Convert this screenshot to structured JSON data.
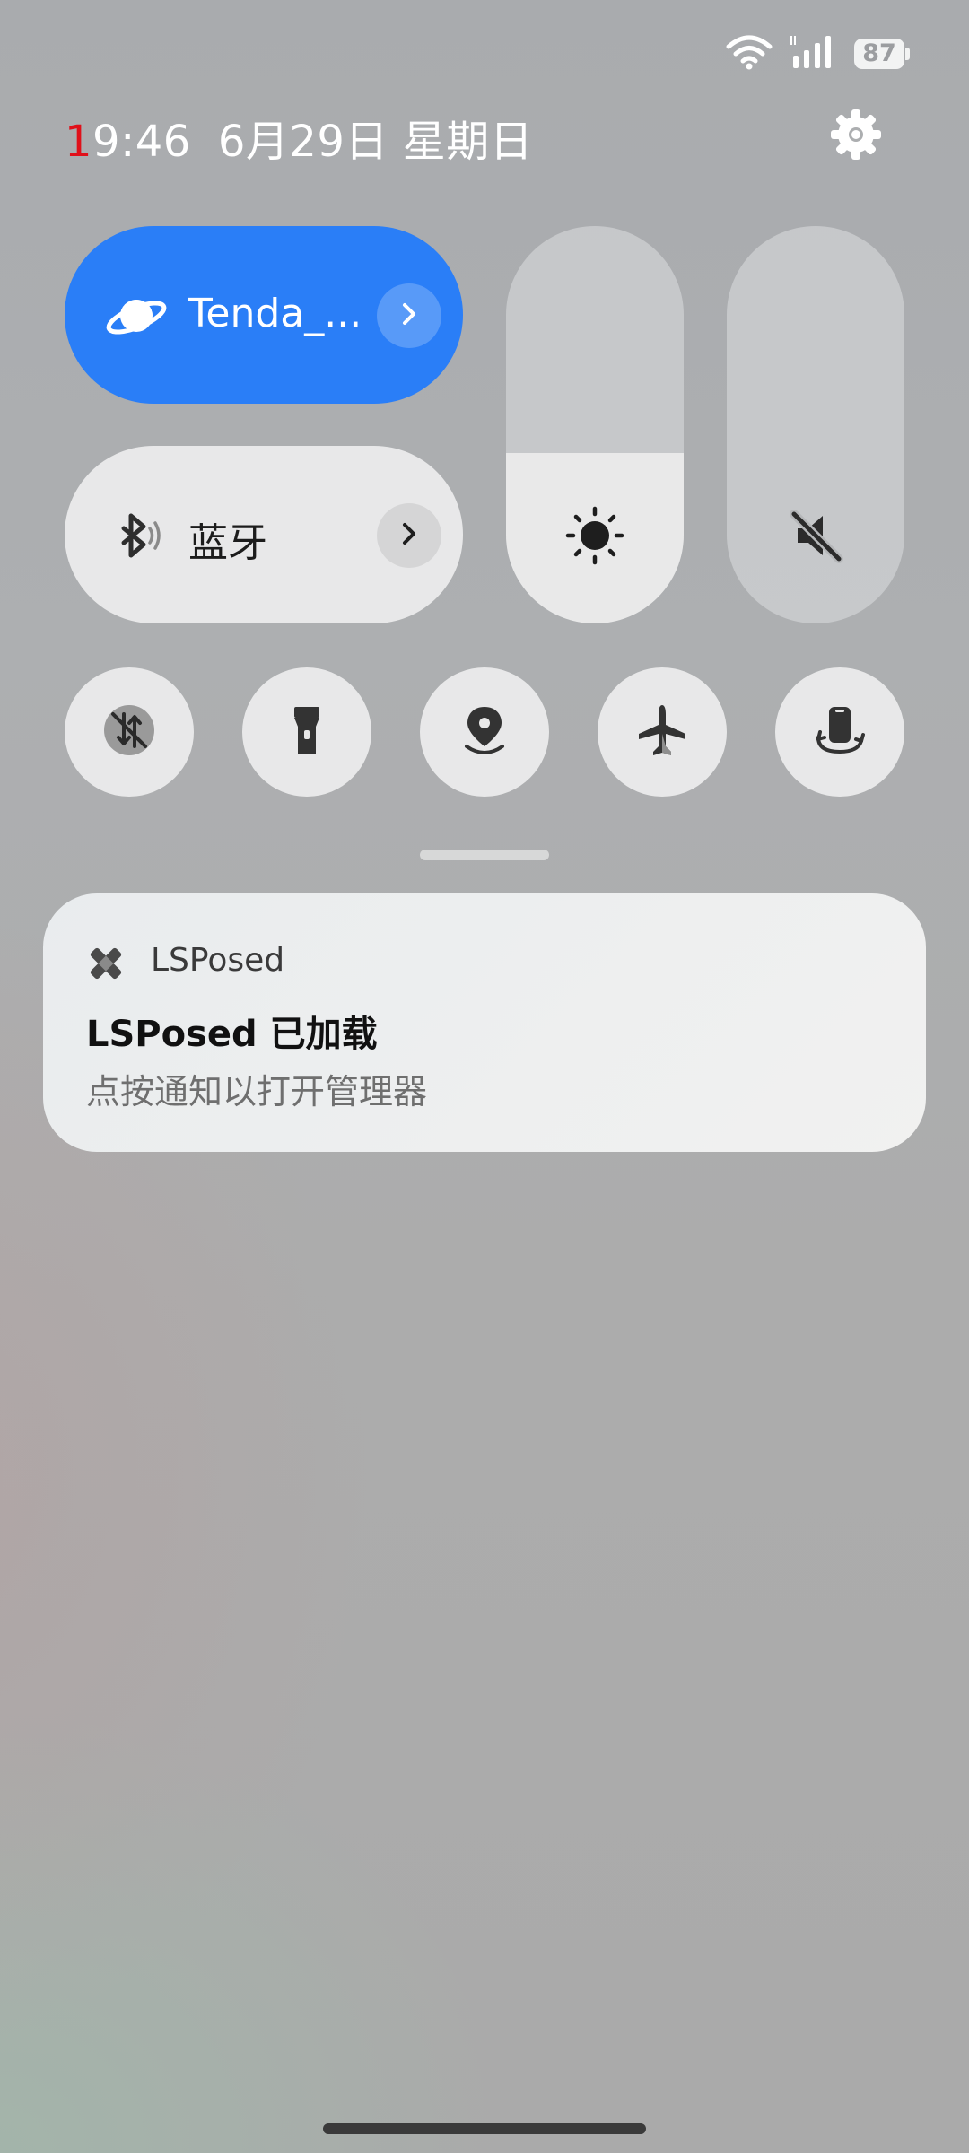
{
  "status_bar": {
    "battery_level": "87",
    "icons": [
      "wifi-icon",
      "signal-icon",
      "battery-icon"
    ]
  },
  "header": {
    "time_first_digit": "1",
    "time_rest": "9:46",
    "date": "6月29日 星期日",
    "settings_icon": "gear-icon"
  },
  "tiles": {
    "wifi": {
      "label": "Tenda_...",
      "icon": "planet-icon",
      "active": true,
      "color": "#2a7ef7"
    },
    "bluetooth": {
      "label": "蓝牙",
      "icon": "bluetooth-icon",
      "active": false
    }
  },
  "sliders": {
    "brightness": {
      "icon": "sun-icon",
      "level": 0.43
    },
    "volume": {
      "icon": "volume-mute-icon",
      "level": 0.0
    }
  },
  "toggles": [
    {
      "name": "mobile-data-off",
      "icon": "mobile-data-off-icon"
    },
    {
      "name": "flashlight",
      "icon": "flashlight-icon"
    },
    {
      "name": "location",
      "icon": "location-icon"
    },
    {
      "name": "airplane-mode",
      "icon": "airplane-icon"
    },
    {
      "name": "auto-rotate",
      "icon": "rotate-icon"
    }
  ],
  "notification": {
    "app_name": "LSPosed",
    "title": "LSPosed 已加载",
    "body": "点按通知以打开管理器"
  }
}
